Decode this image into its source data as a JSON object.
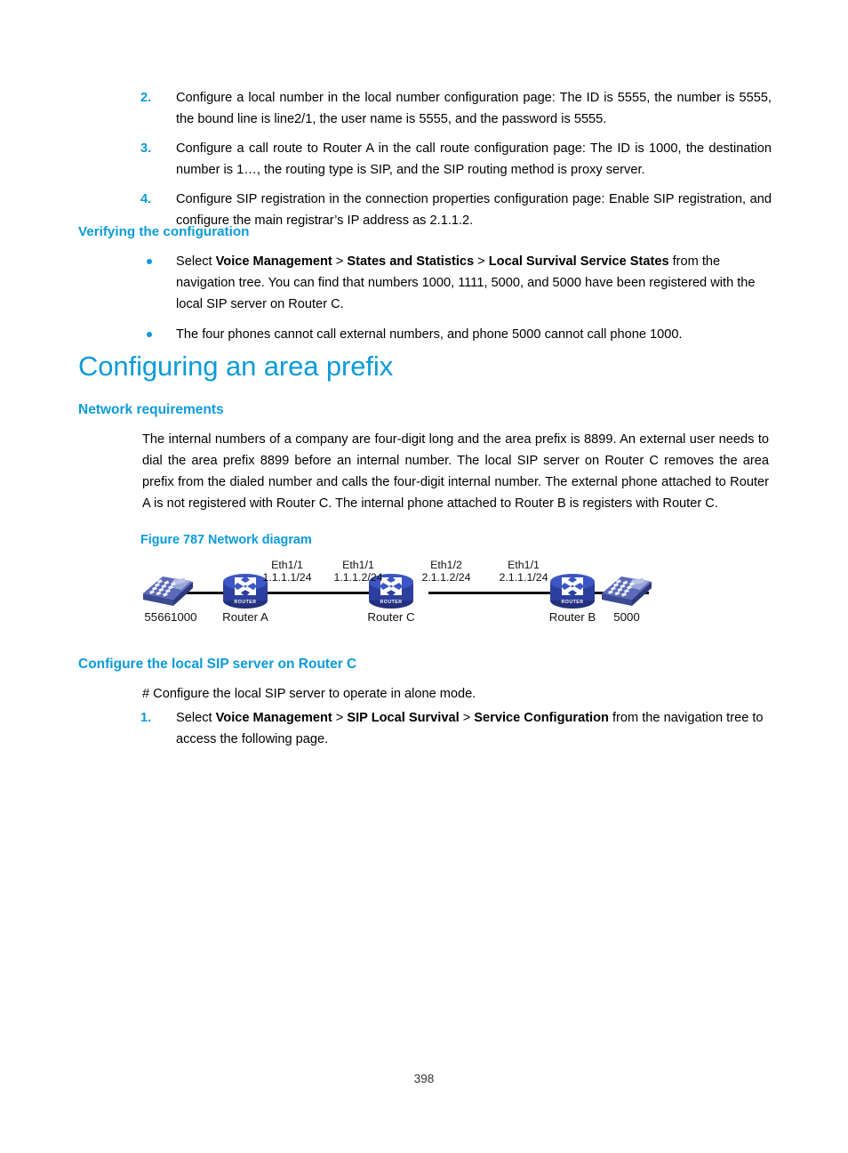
{
  "page": {
    "number": "398"
  },
  "top_list": {
    "items": [
      {
        "marker": "2.",
        "text": "Configure a local number in the local number configuration page: The ID is 5555, the number is 5555, the bound line is line2/1, the user name is 5555, and the password is 5555."
      },
      {
        "marker": "3.",
        "text": "Configure a call route to Router A in the call route configuration page: The ID is 1000, the destination number is 1…, the routing type is SIP, and the SIP routing method is proxy server."
      },
      {
        "marker": "4.",
        "text": "Configure SIP registration in the connection properties configuration page: Enable SIP registration, and configure the main registrar’s IP address as 2.1.1.2."
      }
    ]
  },
  "verifying": {
    "heading": "Verifying the configuration",
    "bullets": [
      {
        "prefix": "Select ",
        "bold1": "Voice Management",
        "sep1": " > ",
        "bold2": "States and Statistics",
        "sep2": " > ",
        "bold3": "Local Survival Service States",
        "suffix": " from the navigation tree. You can find that numbers 1000, 1111, 5000, and 5000 have been registered with the local SIP server on Router C."
      },
      {
        "text": "The four phones cannot call external numbers, and phone 5000 cannot call phone 1000."
      }
    ]
  },
  "section": {
    "title": "Configuring an area prefix",
    "network_requirements": {
      "heading": "Network requirements",
      "paragraph": "The internal numbers of a company are four-digit long and the area prefix is 8899. An external user needs to dial the area prefix 8899 before an internal number. The local SIP server on Router C removes the area prefix from the dialed number and calls the four-digit internal number. The external phone attached to Router A is not registered with Router C. The internal phone attached to Router B is registers with Router C."
    }
  },
  "figure": {
    "caption": "Figure 787 Network diagram",
    "nodes": [
      {
        "type": "phone",
        "label": "55661000"
      },
      {
        "type": "router",
        "label": "Router A"
      },
      {
        "type": "router",
        "label": "Router C"
      },
      {
        "type": "router",
        "label": "Router B"
      },
      {
        "type": "phone",
        "label": "5000"
      }
    ],
    "router_badge": "ROUTER",
    "interfaces": [
      {
        "name": "Eth1/1",
        "address": "1.1.1.1/24"
      },
      {
        "name": "Eth1/1",
        "address": "1.1.1.2/24"
      },
      {
        "name": "Eth1/2",
        "address": "2.1.1.2/24"
      },
      {
        "name": "Eth1/1",
        "address": "2.1.1.1/24"
      }
    ],
    "colors": {
      "router_body": "#2c3f9e",
      "router_top": "#3c56c4",
      "phone_body": "#4a5bab",
      "link": "#111111"
    }
  },
  "configure_sip": {
    "heading": "Configure the local SIP server on Router C",
    "comment": "# Configure the local SIP server to operate in alone mode.",
    "step": {
      "marker": "1.",
      "prefix": "Select ",
      "bold1": "Voice Management",
      "sep1": " > ",
      "bold2": "SIP Local Survival",
      "sep2": " > ",
      "bold3": "Service Configuration",
      "suffix": " from the navigation tree to access the following page."
    }
  },
  "theme": {
    "accent": "#0b9bd8",
    "text": "#1a1a1a"
  }
}
